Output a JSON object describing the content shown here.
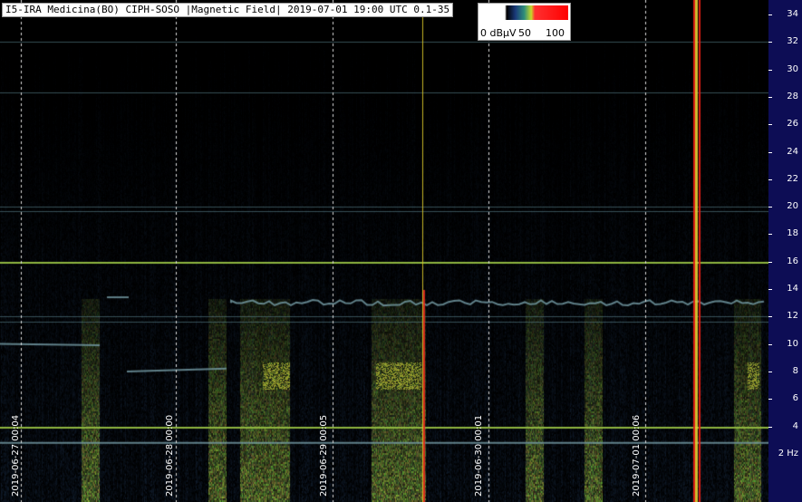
{
  "header": {
    "title": "I5-IRA Medicina(BO) CIPH-SOSO |Magnetic Field| 2019-07-01 19:00 UTC 0.1-35"
  },
  "colorbar": {
    "labels": [
      "0 dBµV",
      "50",
      "100"
    ],
    "stops": [
      "#ffffff",
      "#000000",
      "#1a3a7a",
      "#2f8f7a",
      "#c8d82a",
      "#ff3030",
      "#ff0000"
    ]
  },
  "yaxis": {
    "unit_label": "2 Hz",
    "ticks": [
      "34",
      "32",
      "30",
      "28",
      "26",
      "24",
      "22",
      "20",
      "18",
      "16",
      "14",
      "12",
      "10",
      "8",
      "6",
      "4"
    ]
  },
  "dates": [
    "2019-06-27 00:04",
    "2019-06-28 00:00",
    "2019-06-29 00:05",
    "2019-06-30 00:01",
    "2019-07-01 00:06"
  ],
  "colors": {
    "background": "#000000",
    "axis_bg": "#0d0d55",
    "band_line": "#8fb640",
    "grid": "#dddddd"
  }
}
